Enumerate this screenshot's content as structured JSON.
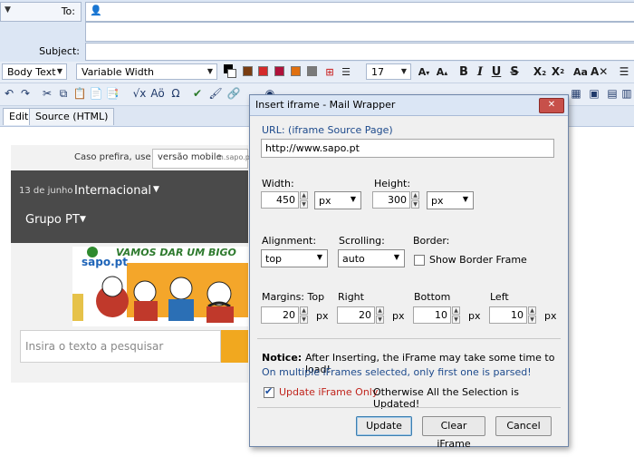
{
  "header": {
    "to_label": "To:",
    "subject_label": "Subject:",
    "to_value": "",
    "subject_value": ""
  },
  "toolbar": {
    "paragraph_style": "Body Text",
    "font_family": "Variable Width",
    "font_size": "17",
    "colors": [
      "#000000",
      "#ffffff",
      "#7a3d12",
      "#d42a2a",
      "#b0123b",
      "#e07010",
      "#7a7a7a"
    ]
  },
  "tabs": [
    {
      "label": "Edit"
    },
    {
      "label": "Source (HTML)"
    }
  ],
  "content": {
    "mobile_prompt": "Caso prefira, use a",
    "mobile_link": "versão mobile",
    "mobile_domain": "m.sapo.pt",
    "date": "13 de junho",
    "section": "Internacional",
    "group": "Grupo PT",
    "banner_brand": "sapo.pt",
    "banner_text": "VAMOS DAR UM BIGO",
    "search_placeholder": "Insira o texto a pesquisar"
  },
  "dialog": {
    "title": "Insert iframe - Mail Wrapper",
    "url_label": "URL: (iframe Source Page)",
    "url_value": "http://www.sapo.pt",
    "width_label": "Width:",
    "width_value": "450",
    "width_unit": "px",
    "height_label": "Height:",
    "height_value": "300",
    "height_unit": "px",
    "alignment_label": "Alignment:",
    "alignment_value": "top",
    "scrolling_label": "Scrolling:",
    "scrolling_value": "auto",
    "border_label": "Border:",
    "show_border_label": "Show Border Frame",
    "margins_top_label": "Margins: Top",
    "margin_top": "20",
    "right_label": "Right",
    "margin_right": "20",
    "bottom_label": "Bottom",
    "margin_bottom": "10",
    "left_label": "Left",
    "margin_left": "10",
    "px": "px",
    "notice_label": "Notice:",
    "notice_text": "After Inserting, the iFrame may take some time to load!",
    "notice_text2": "On multiple iFrames selected, only first one is parsed!",
    "update_only_label": "Update iFrame Only",
    "update_only_checked": true,
    "otherwise_text": "Otherwise All the Selection is Updated!",
    "update_button": "Update",
    "clear_button": "Clear iFrame",
    "cancel_button": "Cancel"
  }
}
